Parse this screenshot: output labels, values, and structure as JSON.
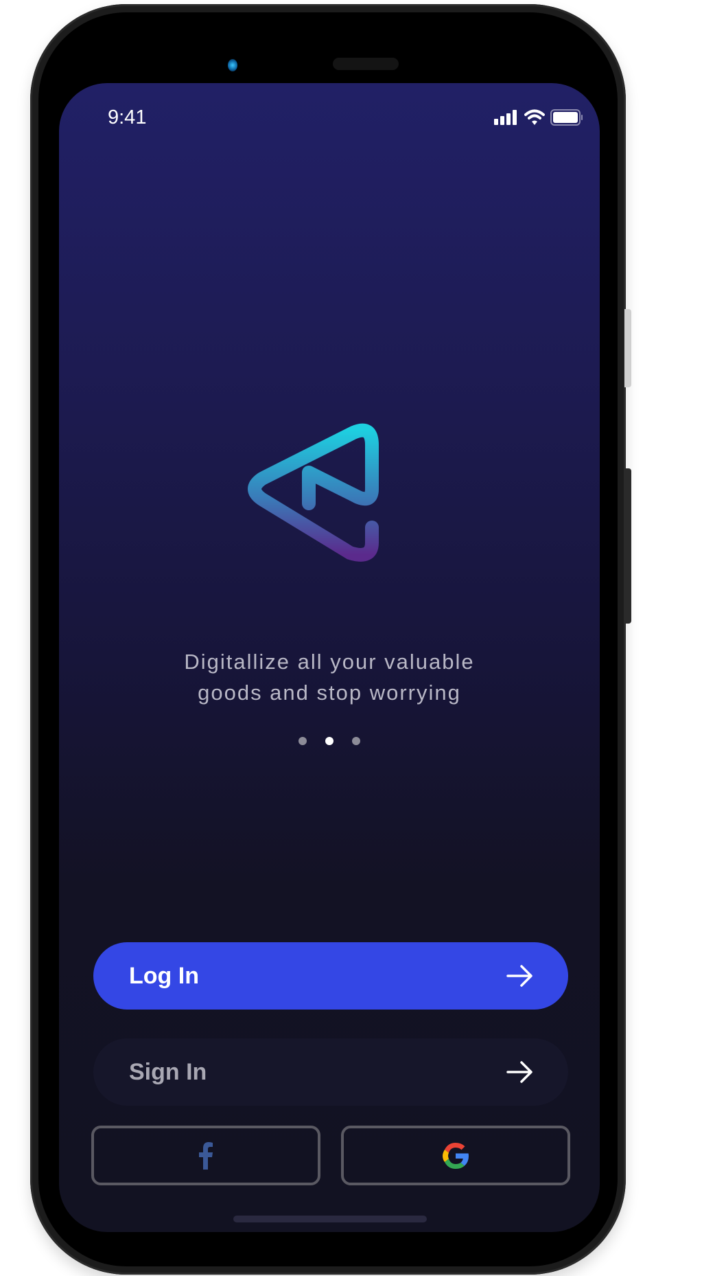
{
  "status_bar": {
    "time": "9:41",
    "icons": [
      "signal-icon",
      "wifi-icon",
      "battery-icon"
    ]
  },
  "onboarding": {
    "tagline_line1": "Digitallize all your valuable",
    "tagline_line2": "goods and stop worrying",
    "page_count": 3,
    "active_page": 2
  },
  "actions": {
    "login_label": "Log In",
    "signin_label": "Sign In",
    "social": [
      "facebook-icon",
      "google-icon"
    ]
  },
  "colors": {
    "accent": "#3447e5",
    "logo_top": "#1ecfe0",
    "logo_bottom": "#5b2a8c",
    "facebook": "#3b5998"
  }
}
